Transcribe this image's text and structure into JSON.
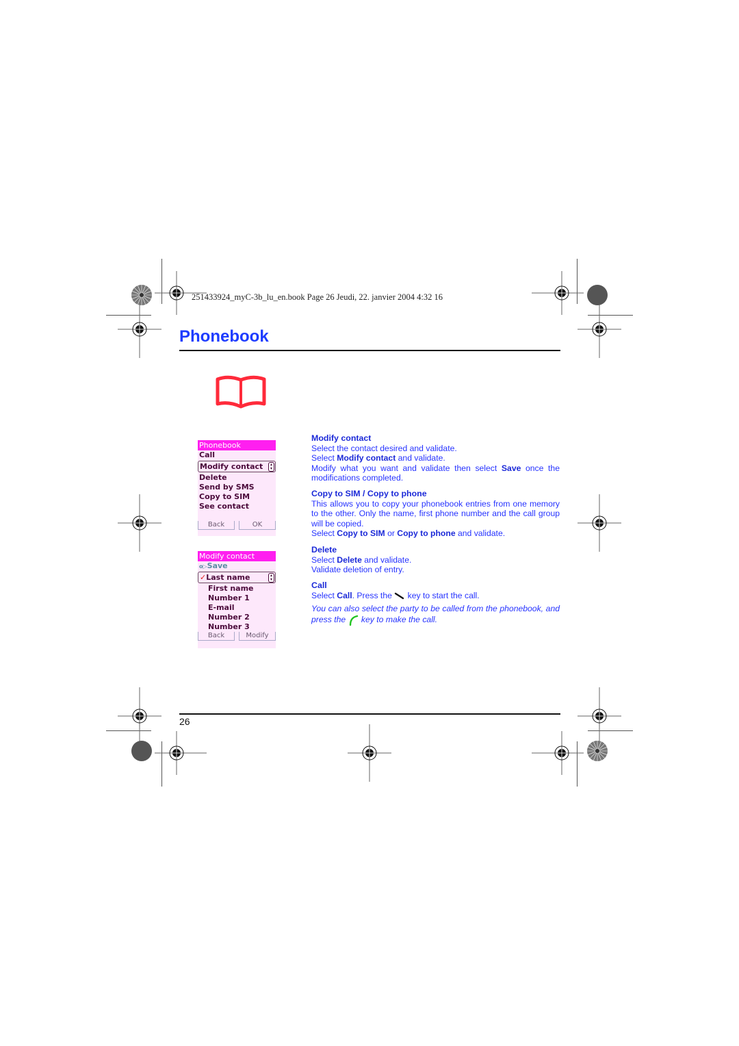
{
  "header": {
    "print_info": "251433924_myC-3b_lu_en.book  Page 26  Jeudi, 22. janvier 2004  4:32 16"
  },
  "page": {
    "title": "Phonebook",
    "number": "26",
    "icon": "book-icon",
    "accent_color": "#1e3cff"
  },
  "screen1": {
    "title": "Phonebook",
    "items": [
      "Call",
      "Modify contact",
      "Delete",
      "Send by SMS",
      "Copy to SIM",
      "See contact"
    ],
    "selected_index": 1,
    "softkeys": {
      "left": "Back",
      "right": "OK"
    }
  },
  "screen2": {
    "title": "Modify contact",
    "save_label": "Save",
    "selected_item": "Last name",
    "items": [
      "First name",
      "Number 1",
      "E-mail",
      "Number 2",
      "Number 3"
    ],
    "softkeys": {
      "left": "Back",
      "right": "Modify"
    }
  },
  "sections": {
    "modify": {
      "heading": "Modify contact",
      "line1": "Select the contact desired and validate.",
      "line2_pre": "Select ",
      "line2_bold": "Modify contact",
      "line2_post": " and validate.",
      "line3_pre": "Modify what you want and validate then select ",
      "line3_bold": "Save",
      "line3_post": " once the modifications completed."
    },
    "copy": {
      "heading": "Copy to SIM / Copy to phone",
      "para": "This allows you to copy your phonebook entries from one memory to the other. Only the name, first phone number and the call group will be copied.",
      "line_pre": "Select ",
      "line_bold1": "Copy to SIM",
      "line_mid": " or ",
      "line_bold2": "Copy to phone",
      "line_post": " and validate."
    },
    "delete": {
      "heading": "Delete",
      "line1_pre": "Select ",
      "line1_bold": "Delete",
      "line1_post": " and validate.",
      "line2": "Validate deletion of entry."
    },
    "call": {
      "heading": "Call",
      "line1_pre": "Select ",
      "line1_bold": "Call",
      "line1_mid": ". Press the ",
      "line1_post": " key to start the call.",
      "note_pre": "You can also select the party to be called from the phonebook, and press the ",
      "note_post": " key to make the call."
    }
  }
}
